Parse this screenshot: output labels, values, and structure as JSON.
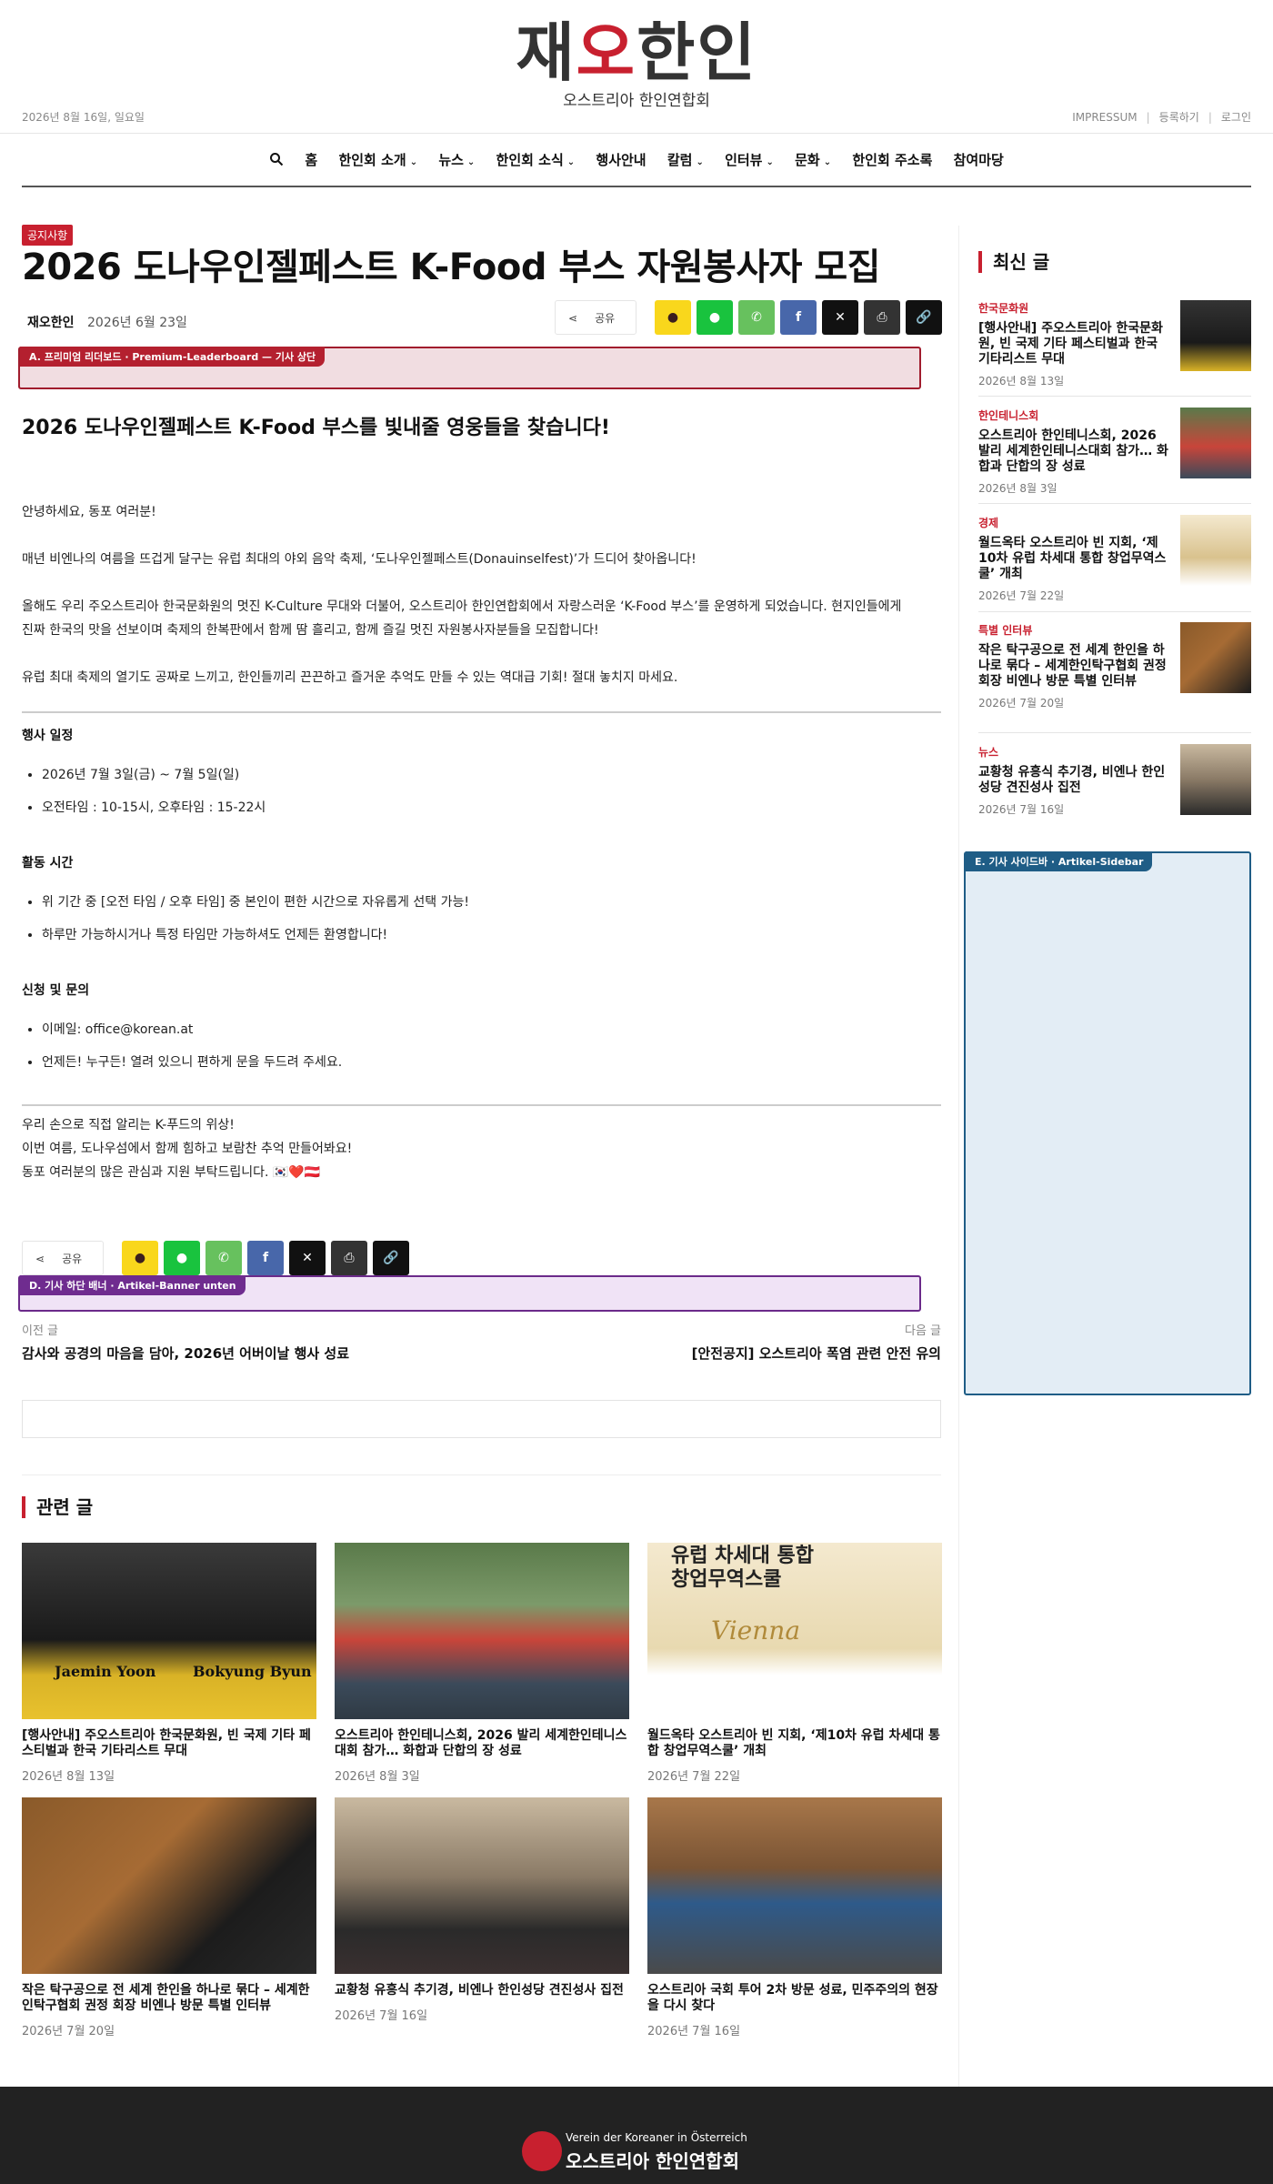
{
  "header": {
    "logo_main_a": "재",
    "logo_main_b": "오",
    "logo_main_c": "한인",
    "logo_sub": "오스트리아 한인연합회",
    "date": "2026년 8월 16일, 일요일",
    "links": [
      "IMPRESSUM",
      "등록하기",
      "로그인"
    ]
  },
  "nav": {
    "items": [
      {
        "label": "홈",
        "dropdown": false
      },
      {
        "label": "한인회 소개",
        "dropdown": true
      },
      {
        "label": "뉴스",
        "dropdown": true
      },
      {
        "label": "한인회 소식",
        "dropdown": true
      },
      {
        "label": "행사안내",
        "dropdown": false
      },
      {
        "label": "칼럼",
        "dropdown": true
      },
      {
        "label": "인터뷰",
        "dropdown": true
      },
      {
        "label": "문화",
        "dropdown": true
      },
      {
        "label": "한인회 주소록",
        "dropdown": false
      },
      {
        "label": "참여마당",
        "dropdown": false
      }
    ]
  },
  "article": {
    "category": "공지사항",
    "title": "2026 도나우인젤페스트 K-Food 부스 자원봉사자 모집",
    "author": "재오한인",
    "date": "2026년 6월 23일",
    "share_label": "공유",
    "subtitle": "2026 도나우인젤페스트 K-Food 부스를 빛내줄 영웅들을 찾습니다!",
    "p1": "안녕하세요, 동포 여러분!",
    "p2": "매년 비엔나의 여름을 뜨겁게 달구는 유럽 최대의 야외 음악 축제, ‘도나우인젤페스트(Donauinselfest)’가 드디어 찾아옵니다!",
    "p3a": "올해도 우리 주오스트리아 한국문화원의 멋진 K-Culture 무대와 더불어, 오스트리아 한인연합회에서 자랑스러운 ‘K-Food 부스’를 운영하게 되었습니다. 현지인들에게",
    "p3b": "진짜 한국의 맛을 선보이며 축제의 한복판에서 함께 땀 흘리고, 함께 즐길 멋진 자원봉사자분들을 모집합니다!",
    "p4": "유럽 최대 축제의 열기도 공짜로 느끼고, 한인들끼리 끈끈하고 즐거운 추억도 만들 수 있는 역대급 기회! 절대 놓치지 마세요.",
    "s1": "행사 일정",
    "s1_items": [
      "2026년 7월 3일(금) ~ 7월 5일(일)",
      "오전타임 : 10-15시, 오후타임 : 15-22시"
    ],
    "s2": "활동 시간",
    "s2_items": [
      "위 기간 중 [오전 타임 / 오후 타임] 중 본인이 편한 시간으로 자유롭게 선택 가능!",
      "하루만 가능하시거나 특정 타임만 가능하셔도 언제든 환영합니다!"
    ],
    "s3": "신청 및 문의",
    "s3_items": [
      "이메일: office@korean.at",
      "언제든! 누구든! 열려 있으니 편하게 문을 두드려 주세요."
    ],
    "c1": "우리 손으로 직접 알리는 K-푸드의 위상!",
    "c2": "이번 여름, 도나우섬에서 함께 힘하고 보람찬 추억 만들어봐요!",
    "c3": "동포 여러분의 많은 관심과 지원 부탁드립니다. 🇰🇷❤️🇦🇹"
  },
  "ads": {
    "a_label": "A. 프리미엄 리더보드 · Premium-Leaderboard — 기사 상단",
    "d_label": "D. 기사 하단 배너 · Artikel-Banner unten",
    "e_label": "E. 기사 사이드바 · Artikel-Sidebar"
  },
  "postnav": {
    "prev_label": "이전 글",
    "prev_title": "감사와 공경의 마음을 담아, 2026년 어버이날 행사 성료",
    "next_label": "다음 글",
    "next_title": "[안전공지] 오스트리아 폭염 관련 안전 유의"
  },
  "related": {
    "heading": "관련 글",
    "cards": [
      {
        "title": "[행사안내] 주오스트리아 한국문화원, 빈 국제 기타 페스티벌과 한국 기타리스트 무대",
        "date": "2026년 8월 13일",
        "img": {
          "name1": "Jaemin Yoon",
          "name2": "Bokyung Byun"
        }
      },
      {
        "title": "오스트리아 한인테니스회, 2026 발리 세계한인테니스대회 참가… 화합과 단합의 장 성료",
        "date": "2026년 8월 3일"
      },
      {
        "title": "월드옥타 오스트리아 빈 지회, ‘제10차 유럽 차세대 통합 창업무역스쿨’ 개최",
        "date": "2026년 7월 22일",
        "img": {
          "line1": "유럽 차세대 통합",
          "line2": "창업무역스쿨",
          "line3": "Vienna"
        }
      },
      {
        "title": "작은 탁구공으로 전 세계 한인을 하나로 묶다 – 세계한인탁구협회 권정 회장 비엔나 방문 특별 인터뷰",
        "date": "2026년 7월 20일"
      },
      {
        "title": "교황청 유흥식 추기경, 비엔나 한인성당 견진성사 집전",
        "date": "2026년 7월 16일"
      },
      {
        "title": "오스트리아 국회 투어 2차 방문 성료, 민주주의의 현장을 다시 찾다",
        "date": "2026년 7월 16일"
      }
    ]
  },
  "sidebar": {
    "heading": "최신 글",
    "items": [
      {
        "cat": "한국문화원",
        "title": "[행사안내] 주오스트리아 한국문화원, 빈 국제 기타 페스티벌과 한국 기타리스트 무대",
        "date": "2026년 8월 13일"
      },
      {
        "cat": "한인테니스회",
        "title": "오스트리아 한인테니스회, 2026 발리 세계한인테니스대회 참가… 화합과 단합의 장 성료",
        "date": "2026년 8월 3일"
      },
      {
        "cat": "경제",
        "title": "월드옥타 오스트리아 빈 지회, ‘제10차 유럽 차세대 통합 창업무역스쿨’ 개최",
        "date": "2026년 7월 22일"
      },
      {
        "cat": "특별 인터뷰",
        "title": "작은 탁구공으로 전 세계 한인을 하나로 묶다 – 세계한인탁구협회 권정 회장 비엔나 방문 특별 인터뷰",
        "date": "2026년 7월 20일"
      },
      {
        "cat": "뉴스",
        "title": "교황청 유흥식 추기경, 비엔나 한인성당 견진성사 집전",
        "date": "2026년 7월 16일"
      }
    ]
  },
  "footer": {
    "line1": "Verein der Koreaner in Österreich",
    "line2": "오스트리아 한인연합회"
  },
  "colors": {
    "accent": "#c8202f",
    "footer_bg": "#222222",
    "kakao": "#f9d71c",
    "naver": "#19c33e",
    "whatsapp": "#67c15e",
    "facebook": "#4867aa"
  }
}
